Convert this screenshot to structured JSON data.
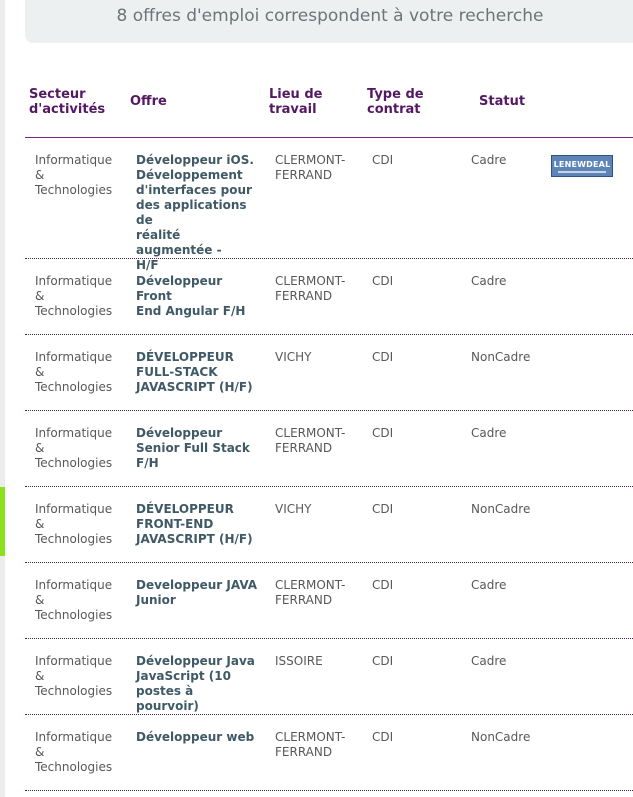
{
  "banner": {
    "text": "8 offres d'emploi correspondent à votre recherche"
  },
  "table": {
    "headers": {
      "secteur": "Secteur\nd'activités",
      "offre": "Offre",
      "lieu": "Lieu de\ntravail",
      "type": "Type de\ncontrat",
      "statut": "Statut"
    },
    "rows": [
      {
        "secteur": "Informatique\n&\nTechnologies",
        "offre": "Développeur iOS.\nDéveloppement\nd'interfaces pour\ndes applications de\nréalité augmentée -\nH/F",
        "lieu": "CLERMONT-\nFERRAND",
        "type": "CDI",
        "statut": "Cadre",
        "logo": "LENEWDEAL"
      },
      {
        "secteur": "Informatique\n&\nTechnologies",
        "offre": "Développeur Front\nEnd Angular F/H",
        "lieu": "CLERMONT-\nFERRAND",
        "type": "CDI",
        "statut": "Cadre"
      },
      {
        "secteur": "Informatique\n&\nTechnologies",
        "offre": "DÉVELOPPEUR\nFULL-STACK\nJAVASCRIPT (H/F)",
        "lieu": "VICHY",
        "type": "CDI",
        "statut": "NonCadre"
      },
      {
        "secteur": "Informatique\n&\nTechnologies",
        "offre": "Développeur\nSenior Full Stack\nF/H",
        "lieu": "CLERMONT-\nFERRAND",
        "type": "CDI",
        "statut": "Cadre"
      },
      {
        "secteur": "Informatique\n&\nTechnologies",
        "offre": "DÉVELOPPEUR\nFRONT-END\nJAVASCRIPT (H/F)",
        "lieu": "VICHY",
        "type": "CDI",
        "statut": "NonCadre"
      },
      {
        "secteur": "Informatique\n&\nTechnologies",
        "offre": "Developpeur JAVA\nJunior",
        "lieu": "CLERMONT-\nFERRAND",
        "type": "CDI",
        "statut": "Cadre"
      },
      {
        "secteur": "Informatique\n&\nTechnologies",
        "offre": "Développeur Java\nJavaScript (10\npostes à  pourvoir)",
        "lieu": "ISSOIRE",
        "type": "CDI",
        "statut": "Cadre"
      },
      {
        "secteur": "Informatique\n&\nTechnologies",
        "offre": "Développeur web",
        "lieu": "CLERMONT-\nFERRAND",
        "type": "CDI",
        "statut": "NonCadre"
      }
    ]
  }
}
